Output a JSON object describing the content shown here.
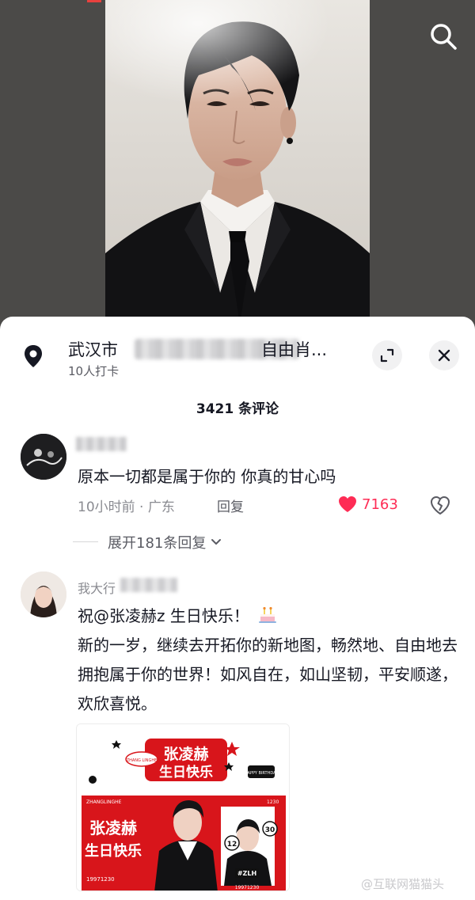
{
  "header": {
    "search_icon": "search-icon"
  },
  "location": {
    "title_prefix": "武汉市",
    "title_suffix": "自由肖...",
    "checkins": "10人打卡",
    "pin_icon": "location-pin-icon",
    "expand_icon": "expand-icon",
    "close_icon": "close-icon"
  },
  "comments": {
    "count_label": "3421 条评论",
    "items": [
      {
        "text": "原本一切都是属于你的 你真的甘心吗",
        "time_location": "10小时前 · 广东",
        "reply_label": "回复",
        "likes": "7163",
        "expand_label": "展开181条回复"
      },
      {
        "author_visible": "我大行",
        "line1_prefix": "祝",
        "mention": "@张凌赫z",
        "line1_suffix": " 生日快乐！",
        "body": "新的一岁，继续去开拓你的新地图，畅然地、自由地去拥抱属于你的世界！如风自在，如山坚韧，平安顺遂，欢欣喜悦。"
      }
    ]
  },
  "poster": {
    "title_top_line1": "张凌赫",
    "title_top_line2": "生日快乐",
    "badge_name": "ZHANG LINGHE",
    "happy_birthday": "HAPPY BIRTHDAY",
    "name_latin": "ZHANGLINGHE",
    "code": "1230",
    "date": "19971230",
    "tag": "#ZLH",
    "big_title_line1": "张凌赫",
    "big_title_line2": "生日快乐",
    "number_12": "12",
    "number_30": "30"
  },
  "watermark": "@互联网猫猫头",
  "colors": {
    "like_red": "#fe2c55",
    "poster_red": "#d8151b",
    "sheet_bg": "#ffffff"
  }
}
